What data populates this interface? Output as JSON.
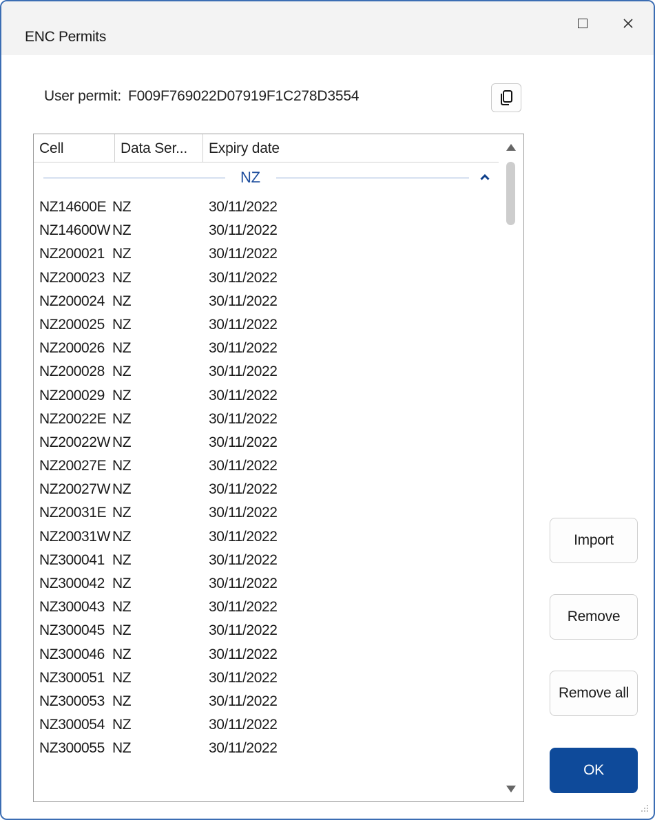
{
  "window": {
    "title": "ENC Permits"
  },
  "permit": {
    "label": "User permit:",
    "value": "F009F769022D07919F1C278D3554"
  },
  "list": {
    "columns": {
      "cell": "Cell",
      "series": "Data Ser...",
      "expiry": "Expiry date"
    },
    "group": {
      "name": "NZ"
    },
    "rows": [
      {
        "cell": "NZ14600E",
        "series": "NZ",
        "expiry": "30/11/2022"
      },
      {
        "cell": "NZ14600W",
        "series": "NZ",
        "expiry": "30/11/2022"
      },
      {
        "cell": "NZ200021",
        "series": "NZ",
        "expiry": "30/11/2022"
      },
      {
        "cell": "NZ200023",
        "series": "NZ",
        "expiry": "30/11/2022"
      },
      {
        "cell": "NZ200024",
        "series": "NZ",
        "expiry": "30/11/2022"
      },
      {
        "cell": "NZ200025",
        "series": "NZ",
        "expiry": "30/11/2022"
      },
      {
        "cell": "NZ200026",
        "series": "NZ",
        "expiry": "30/11/2022"
      },
      {
        "cell": "NZ200028",
        "series": "NZ",
        "expiry": "30/11/2022"
      },
      {
        "cell": "NZ200029",
        "series": "NZ",
        "expiry": "30/11/2022"
      },
      {
        "cell": "NZ20022E",
        "series": "NZ",
        "expiry": "30/11/2022"
      },
      {
        "cell": "NZ20022W",
        "series": "NZ",
        "expiry": "30/11/2022"
      },
      {
        "cell": "NZ20027E",
        "series": "NZ",
        "expiry": "30/11/2022"
      },
      {
        "cell": "NZ20027W",
        "series": "NZ",
        "expiry": "30/11/2022"
      },
      {
        "cell": "NZ20031E",
        "series": "NZ",
        "expiry": "30/11/2022"
      },
      {
        "cell": "NZ20031W",
        "series": "NZ",
        "expiry": "30/11/2022"
      },
      {
        "cell": "NZ300041",
        "series": "NZ",
        "expiry": "30/11/2022"
      },
      {
        "cell": "NZ300042",
        "series": "NZ",
        "expiry": "30/11/2022"
      },
      {
        "cell": "NZ300043",
        "series": "NZ",
        "expiry": "30/11/2022"
      },
      {
        "cell": "NZ300045",
        "series": "NZ",
        "expiry": "30/11/2022"
      },
      {
        "cell": "NZ300046",
        "series": "NZ",
        "expiry": "30/11/2022"
      },
      {
        "cell": "NZ300051",
        "series": "NZ",
        "expiry": "30/11/2022"
      },
      {
        "cell": "NZ300053",
        "series": "NZ",
        "expiry": "30/11/2022"
      },
      {
        "cell": "NZ300054",
        "series": "NZ",
        "expiry": "30/11/2022"
      },
      {
        "cell": "NZ300055",
        "series": "NZ",
        "expiry": "30/11/2022"
      }
    ]
  },
  "buttons": {
    "import": "Import",
    "remove": "Remove",
    "remove_all": "Remove all",
    "ok": "OK"
  },
  "icons": {
    "copy": "copy-icon",
    "maximize": "maximize-icon",
    "close": "close-icon",
    "collapse": "chevron-up-icon"
  },
  "colors": {
    "accent": "#0e4a9a",
    "group_text": "#1e4e9e",
    "window_border": "#3b6db3"
  }
}
